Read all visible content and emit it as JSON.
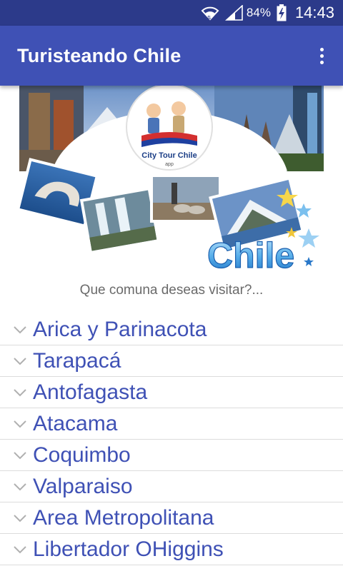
{
  "status_bar": {
    "battery_percent": "84%",
    "time": "14:43",
    "icons": [
      "wifi-icon",
      "signal-icon",
      "battery-charging-icon"
    ]
  },
  "app_bar": {
    "title": "Turisteando Chile",
    "menu_icon": "more-vert-icon"
  },
  "banner": {
    "logo_title": "City Tour Chile",
    "logo_sub": "app",
    "wordmark": "Chile"
  },
  "prompt": "Que comuna deseas visitar?...",
  "regions": [
    {
      "label": "Arica y Parinacota"
    },
    {
      "label": "Tarapacá"
    },
    {
      "label": "Antofagasta"
    },
    {
      "label": "Atacama"
    },
    {
      "label": "Coquimbo"
    },
    {
      "label": "Valparaiso"
    },
    {
      "label": "Area Metropolitana"
    },
    {
      "label": "Libertador OHiggins"
    }
  ],
  "colors": {
    "primary": "#3f51b5",
    "status_bar": "#2c3a8a",
    "list_text": "#3f51b5",
    "divider": "#dcdcdc"
  }
}
